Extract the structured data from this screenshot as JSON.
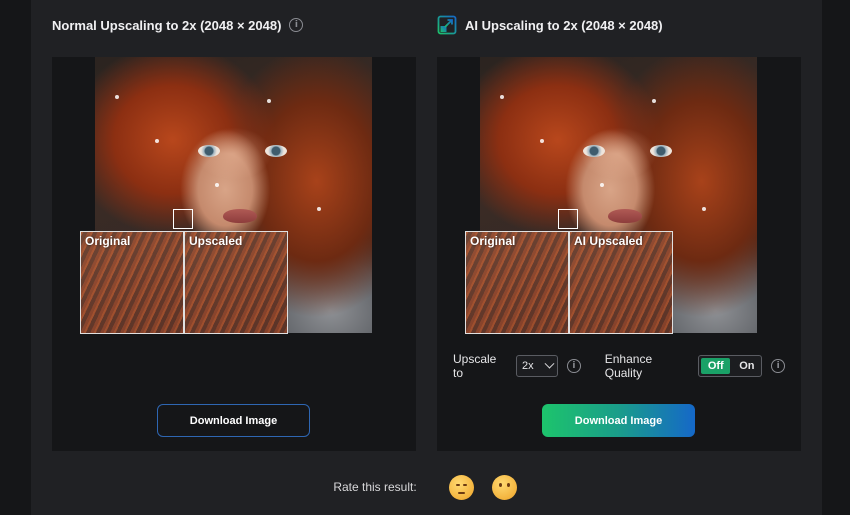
{
  "left_panel": {
    "title": "Normal Upscaling to 2x (2048 × 2048)",
    "zoom_labels": [
      "Original",
      "Upscaled"
    ],
    "download_label": "Download Image"
  },
  "right_panel": {
    "title": "AI Upscaling to 2x (2048 × 2048)",
    "zoom_labels": [
      "Original",
      "AI Upscaled"
    ],
    "upscale_label": "Upscale to",
    "upscale_value": "2x",
    "enhance_label": "Enhance Quality",
    "toggle_off": "Off",
    "toggle_on": "On",
    "toggle_selected": "Off",
    "download_label": "Download Image"
  },
  "rating": {
    "label": "Rate this result:",
    "options": [
      "pensive-face-emoji",
      "face-without-mouth-emoji"
    ]
  },
  "icons": {
    "info": "i",
    "ai_upscale": "ai-upscale-icon"
  },
  "colors": {
    "accent_green": "#1dc46c",
    "accent_blue": "#1568c8",
    "outline_button": "#2e66b2",
    "toggle_active": "#1aa167"
  }
}
